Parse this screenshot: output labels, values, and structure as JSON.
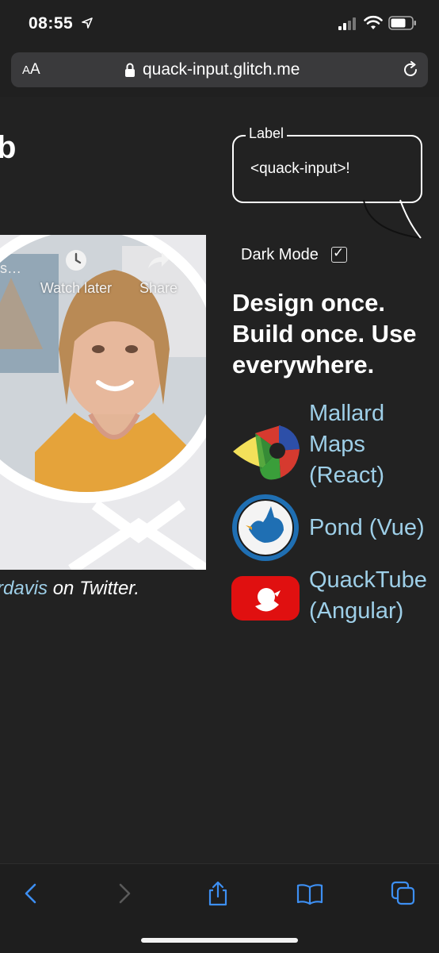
{
  "status_bar": {
    "time": "08:55",
    "icons": [
      "location-arrow-icon",
      "signal-icon",
      "wifi-icon",
      "battery-icon"
    ]
  },
  "browser": {
    "text_size_button": "AA",
    "url": "quack-input.glitch.me",
    "icons": [
      "lock-icon",
      "reload-icon"
    ]
  },
  "page": {
    "heading_fragment": "b",
    "video": {
      "title_fragment": "s…",
      "watch_later_label": "Watch later",
      "share_label": "Share"
    },
    "twitter": {
      "handle_fragment": "rdavis",
      "suffix": " on Twitter."
    },
    "quack_input": {
      "label": "Label",
      "value": "<quack-input>!"
    },
    "dark_mode": {
      "label": "Dark Mode",
      "checked": true,
      "check_glyph": "✓"
    },
    "tagline": "Design once. Build once. Use everywhere.",
    "apps": [
      {
        "label_line1": "Mallard",
        "label_line2": "Maps",
        "label_line3": "(React)",
        "icon": "mallard-maps-icon"
      },
      {
        "label_line1": "Pond (Vue)",
        "icon": "pond-icon"
      },
      {
        "label_line1": "QuackTube",
        "label_line2": "(Angular)",
        "icon": "quacktube-icon"
      }
    ],
    "link_color": "#9ecfe8"
  },
  "toolbar": {
    "icons": [
      "back-icon",
      "forward-icon",
      "share-icon",
      "bookmarks-icon",
      "tabs-icon"
    ],
    "accent_color": "#3d8ff2"
  }
}
